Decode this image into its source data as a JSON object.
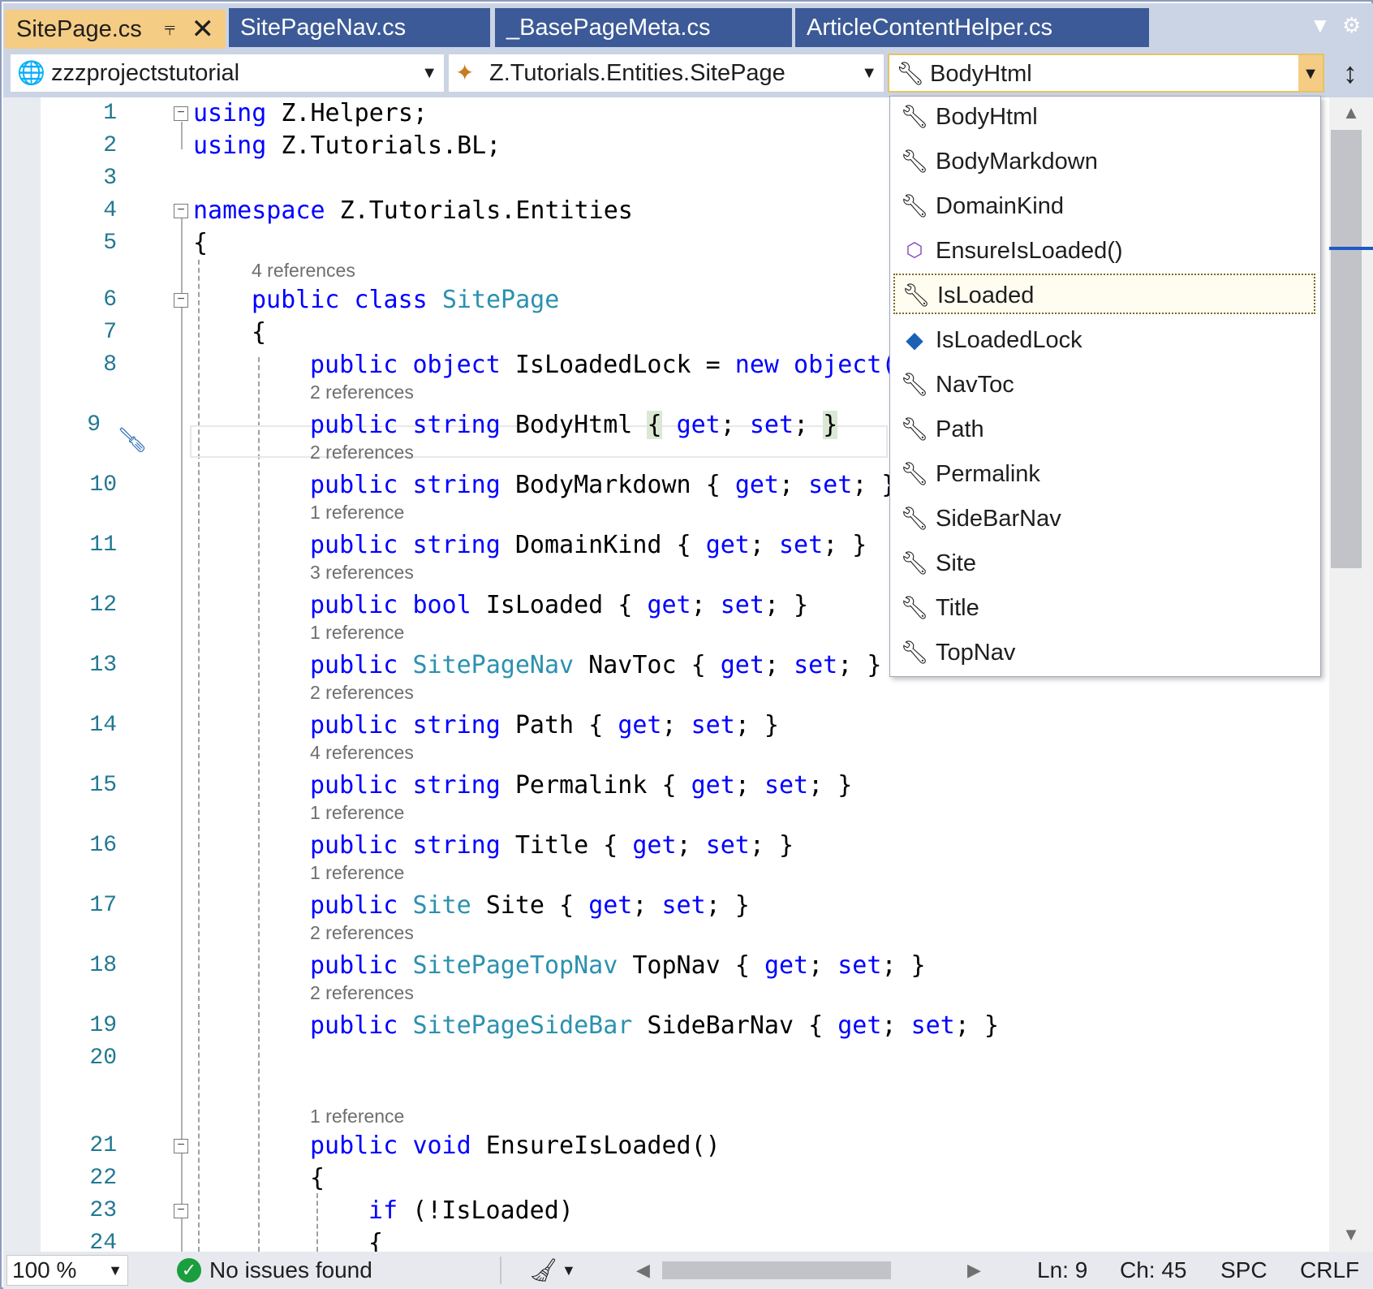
{
  "tabs": [
    {
      "label": "SitePage.cs",
      "active": true
    },
    {
      "label": "SitePageNav.cs",
      "active": false
    },
    {
      "label": "_BasePageMeta.cs",
      "active": false
    },
    {
      "label": "ArticleContentHelper.cs",
      "active": false
    }
  ],
  "navbar": {
    "project": "zzzprojectstutorial",
    "type": "Z.Tutorials.Entities.SitePage",
    "member": "BodyHtml"
  },
  "lines": {
    "n1": "1",
    "n2": "2",
    "n3": "3",
    "n4": "4",
    "n5": "5",
    "n6": "6",
    "n7": "7",
    "n8": "8",
    "n9": "9",
    "n10": "10",
    "n11": "11",
    "n12": "12",
    "n13": "13",
    "n14": "14",
    "n15": "15",
    "n16": "16",
    "n17": "17",
    "n18": "18",
    "n19": "19",
    "n20": "20",
    "n21": "21",
    "n22": "22",
    "n23": "23",
    "n24": "24"
  },
  "code": {
    "l1_kw": "using",
    "l1_rest": " Z.Helpers;",
    "l2_kw": "using",
    "l2_rest": " Z.Tutorials.BL;",
    "l4_kw": "namespace",
    "l4_rest": " Z.Tutorials.Entities",
    "l5": "{",
    "l6_kw1": "public",
    "l6_kw2": "class",
    "l6_ty": "SitePage",
    "l7": "{",
    "l8_kw1": "public",
    "l8_kw2": "object",
    "l8_name": " IsLoadedLock = ",
    "l8_kw3": "new",
    "l8_kw4": "object(",
    "l9_kw1": "public",
    "l9_kw2": "string",
    "l9_name": " BodyHtml ",
    "l10_kw1": "public",
    "l10_kw2": "string",
    "l10_name": " BodyMarkdown ",
    "l11_kw1": "public",
    "l11_kw2": "string",
    "l11_name": " DomainKind ",
    "l12_kw1": "public",
    "l12_kw2": "bool",
    "l12_name": " IsLoaded ",
    "l13_kw1": "public",
    "l13_ty": "SitePageNav",
    "l13_name": " NavToc ",
    "l14_kw1": "public",
    "l14_kw2": "string",
    "l14_name": " Path ",
    "l15_kw1": "public",
    "l15_kw2": "string",
    "l15_name": " Permalink ",
    "l16_kw1": "public",
    "l16_kw2": "string",
    "l16_name": " Title ",
    "l17_kw1": "public",
    "l17_ty": "Site",
    "l17_name": " Site ",
    "l18_kw1": "public",
    "l18_ty": "SitePageTopNav",
    "l18_name": " TopNav ",
    "l19_kw1": "public",
    "l19_ty": "SitePageSideBar",
    "l19_name": " SideBarNav ",
    "l21_kw1": "public",
    "l21_kw2": "void",
    "l21_name": " EnsureIsLoaded()",
    "l22": "{",
    "l23_kw": "if",
    "l23_rest": " (!IsLoaded)",
    "l24": "{",
    "get": "get",
    "set": "set"
  },
  "lens": {
    "l6": "4 references",
    "l9": "2 references",
    "l10": "2 references",
    "l11": "1 reference",
    "l12": "3 references",
    "l13": "1 reference",
    "l14": "2 references",
    "l15": "4 references",
    "l16": "1 reference",
    "l17": "1 reference",
    "l18": "2 references",
    "l19": "2 references",
    "l21": "1 reference"
  },
  "dropdown": {
    "items": [
      {
        "label": "BodyHtml",
        "icon": "wrench-icon"
      },
      {
        "label": "BodyMarkdown",
        "icon": "wrench-icon"
      },
      {
        "label": "DomainKind",
        "icon": "wrench-icon"
      },
      {
        "label": "EnsureIsLoaded()",
        "icon": "method-cube-icon"
      },
      {
        "label": "IsLoaded",
        "icon": "wrench-icon",
        "focused": true
      },
      {
        "label": "IsLoadedLock",
        "icon": "field-icon"
      },
      {
        "label": "NavToc",
        "icon": "wrench-icon"
      },
      {
        "label": "Path",
        "icon": "wrench-icon"
      },
      {
        "label": "Permalink",
        "icon": "wrench-icon"
      },
      {
        "label": "SideBarNav",
        "icon": "wrench-icon"
      },
      {
        "label": "Site",
        "icon": "wrench-icon"
      },
      {
        "label": "Title",
        "icon": "wrench-icon"
      },
      {
        "label": "TopNav",
        "icon": "wrench-icon"
      }
    ]
  },
  "status": {
    "zoom": "100 %",
    "issues": "No issues found",
    "ln": "Ln: 9",
    "ch": "Ch: 45",
    "spc": "SPC",
    "crlf": "CRLF"
  },
  "colors": {
    "keyword": "#0000ff",
    "type": "#2b91af",
    "line_number": "#237893",
    "active_tab": "#f5cc84",
    "inactive_tab": "#3c5a97",
    "ok_green": "#1b9e3e"
  }
}
